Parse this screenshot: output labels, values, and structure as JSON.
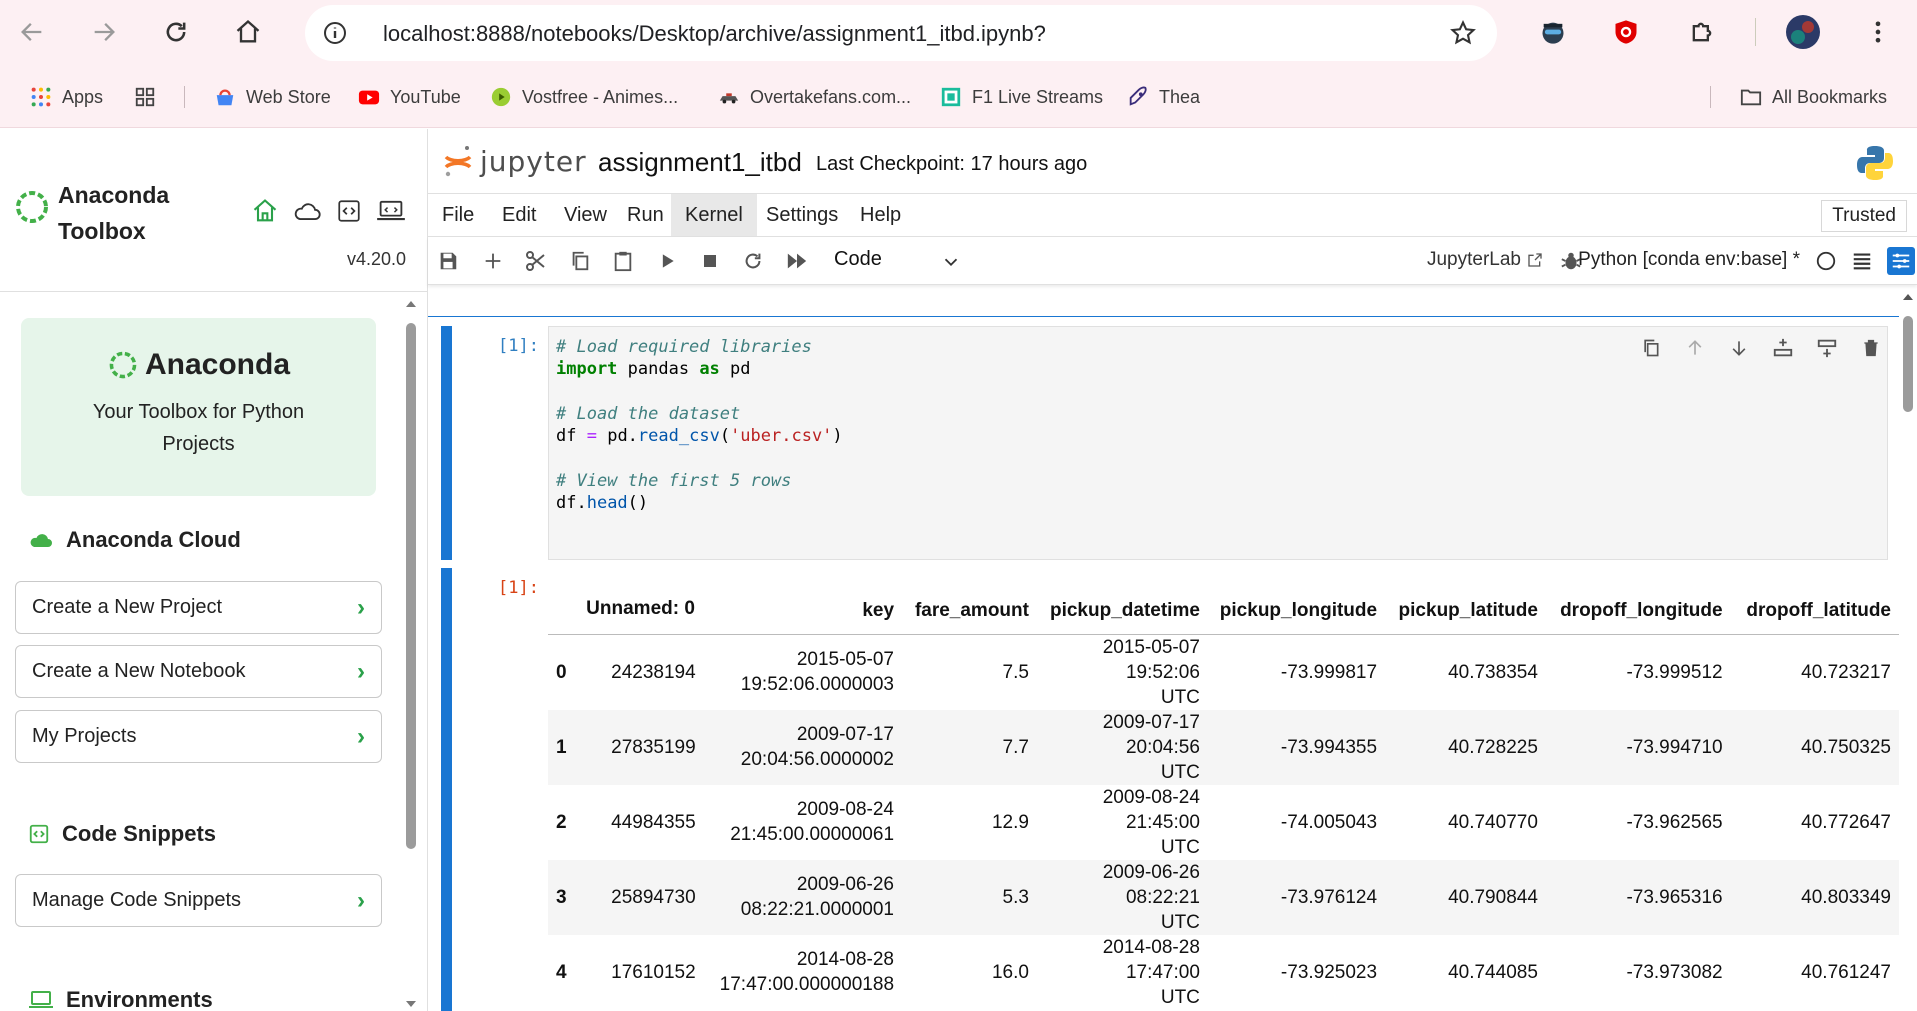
{
  "browser": {
    "url": "localhost:8888/notebooks/Desktop/archive/assignment1_itbd.ipynb?",
    "bookmarks": [
      "Apps",
      "Web Store",
      "YouTube",
      "Vostfree - Animes...",
      "Overtakefans.com...",
      "F1 Live Streams",
      "Thea"
    ],
    "all_bookmarks": "All Bookmarks"
  },
  "toolbox": {
    "title": "Anaconda Toolbox",
    "version": "v4.20.0",
    "hero_brand": "Anaconda",
    "hero_tagline": "Your Toolbox for Python Projects",
    "cloud_heading": "Anaconda Cloud",
    "buttons": [
      "Create a New Project",
      "Create a New Notebook",
      "My Projects"
    ],
    "snippets_heading": "Code Snippets",
    "snippets_button": "Manage Code Snippets",
    "environments_heading": "Environments",
    "accent": "#2aa14a"
  },
  "jupyter": {
    "logo_text": "jupyter",
    "notebook_name": "assignment1_itbd",
    "checkpoint": "Last Checkpoint: 17 hours ago",
    "menus": [
      "File",
      "Edit",
      "View",
      "Run",
      "Kernel",
      "Settings",
      "Help"
    ],
    "active_menu": "Kernel",
    "trusted": "Trusted",
    "cell_type": "Code",
    "jupyterlab_link": "JupyterLab",
    "kernel": "Python [conda env:base] *",
    "accent": "#1976d2"
  },
  "cell": {
    "in_prompt": "[1]:",
    "out_prompt": "[1]:",
    "code_lines": [
      "# Load required libraries",
      "import pandas as pd",
      "",
      "# Load the dataset",
      "df = pd.read_csv('uber.csv')",
      "",
      "# View the first 5 rows",
      "df.head()"
    ]
  },
  "dataframe": {
    "columns": [
      "",
      "Unnamed: 0",
      "key",
      "fare_amount",
      "pickup_datetime",
      "pickup_longitude",
      "pickup_latitude",
      "dropoff_longitude",
      "dropoff_latitude"
    ],
    "rows": [
      [
        "0",
        "24238194",
        "2015-05-07 19:52:06.0000003",
        "7.5",
        "2015-05-07 19:52:06 UTC",
        "-73.999817",
        "40.738354",
        "-73.999512",
        "40.723217"
      ],
      [
        "1",
        "27835199",
        "2009-07-17 20:04:56.0000002",
        "7.7",
        "2009-07-17 20:04:56 UTC",
        "-73.994355",
        "40.728225",
        "-73.994710",
        "40.750325"
      ],
      [
        "2",
        "44984355",
        "2009-08-24 21:45:00.00000061",
        "12.9",
        "2009-08-24 21:45:00 UTC",
        "-74.005043",
        "40.740770",
        "-73.962565",
        "40.772647"
      ],
      [
        "3",
        "25894730",
        "2009-06-26 08:22:21.0000001",
        "5.3",
        "2009-06-26 08:22:21 UTC",
        "-73.976124",
        "40.790844",
        "-73.965316",
        "40.803349"
      ],
      [
        "4",
        "17610152",
        "2014-08-28 17:47:00.000000188",
        "16.0",
        "2014-08-28 17:47:00 UTC",
        "-73.925023",
        "40.744085",
        "-73.973082",
        "40.761247"
      ]
    ]
  }
}
